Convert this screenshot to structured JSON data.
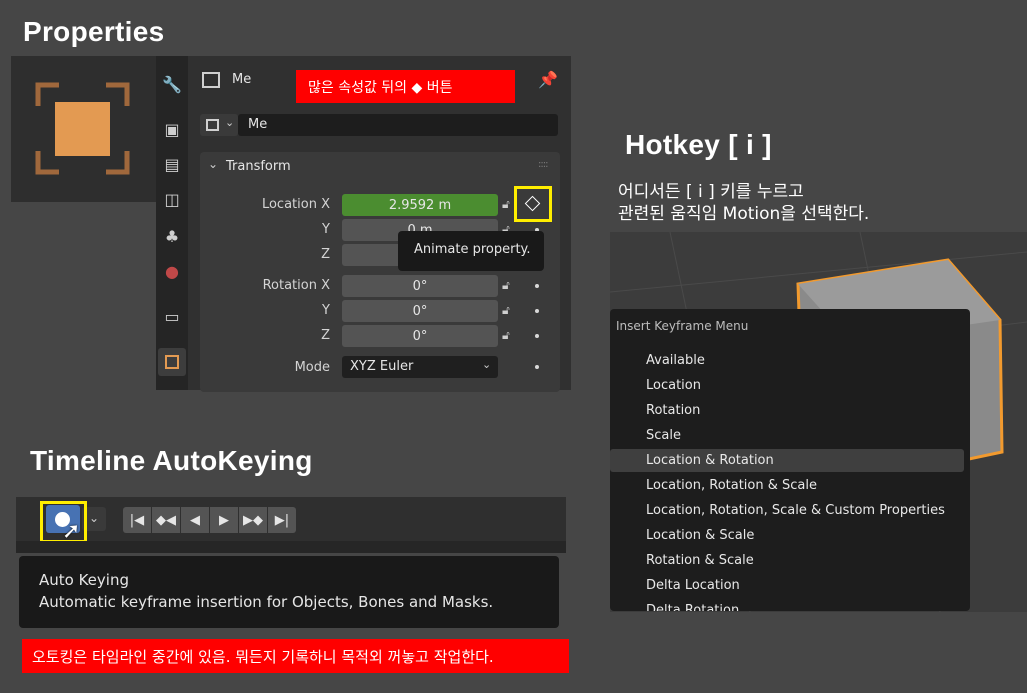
{
  "headings": {
    "properties": "Properties",
    "hotkey": "Hotkey [ i ]",
    "timeline": "Timeline AutoKeying"
  },
  "notes": {
    "properties_note": "많은 속성값 뒤의 ◆ 버튼",
    "hotkey_line1": "어디서든 [ i ] 키를 누르고",
    "hotkey_line2": "관련된 움직임 Motion을 선택한다.",
    "autokey_note": "오토킹은 타임라인 중간에 있음. 뭐든지 기록하니 목적외 꺼놓고 작업한다."
  },
  "properties": {
    "object_name": "Me",
    "data_name": "Me",
    "panel_title": "Transform",
    "location_label": "Location X",
    "y_label": "Y",
    "z_label": "Z",
    "location_x": "2.9592 m",
    "location_y": "0 m",
    "rotation_label": "Rotation X",
    "rotation_x": "0°",
    "rotation_y": "0°",
    "rotation_z": "0°",
    "mode_label": "Mode",
    "mode_value": "XYZ Euler",
    "tooltip": "Animate property."
  },
  "menu": {
    "title": "Insert Keyframe Menu",
    "items": [
      "Available",
      "Location",
      "Rotation",
      "Scale",
      "Location & Rotation",
      "Location, Rotation & Scale",
      "Location, Rotation, Scale & Custom Properties",
      "Location & Scale",
      "Rotation & Scale",
      "Delta Location",
      "Delta Rotation"
    ],
    "highlighted_index": 4
  },
  "timeline": {
    "tooltip_title": "Auto Keying",
    "tooltip_desc": "Automatic keyframe insertion for Objects, Bones and Masks."
  },
  "colors": {
    "accent_green": "#4b8d30",
    "highlight_yellow": "#ffee00",
    "note_red": "#ff0000",
    "object_orange": "#e39a52",
    "autokey_blue": "#4772b3"
  }
}
